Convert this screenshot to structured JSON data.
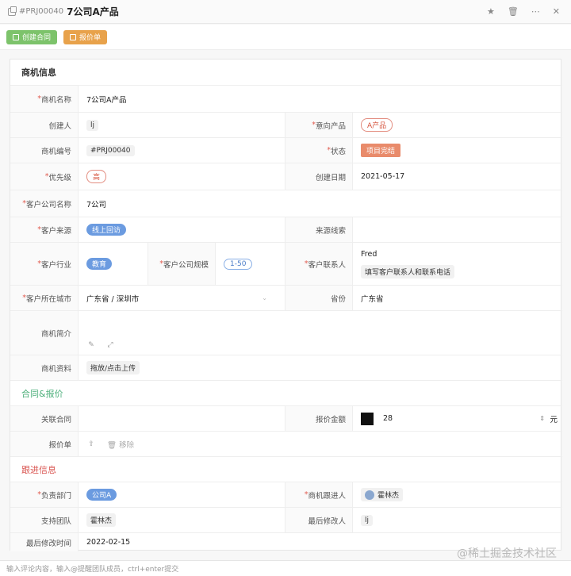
{
  "header": {
    "code": "#PRJ00040",
    "title": "7公司A产品"
  },
  "toolbar": {
    "create_contract": "创建合同",
    "quote": "报价单"
  },
  "sections": {
    "biz": "商机信息",
    "contract": "合同&报价",
    "follow": "跟进信息"
  },
  "fields": {
    "name_label": "商机名称",
    "name": "7公司A产品",
    "creator_label": "创建人",
    "creator": "lj",
    "product_label": "意向产品",
    "product": "A产品",
    "code_label": "商机编号",
    "code": "#PRJ00040",
    "status_label": "状态",
    "status": "项目完结",
    "priority_label": "优先级",
    "priority": "高",
    "created_label": "创建日期",
    "created": "2021-05-17",
    "company_label": "客户公司名称",
    "company": "7公司",
    "source_label": "客户来源",
    "source": "线上回访",
    "clue_label": "来源线索",
    "clue": "",
    "industry_label": "客户行业",
    "industry": "教育",
    "size_label": "客户公司规模",
    "size": "1-50",
    "contact_label": "客户联系人",
    "contact_name": "Fred",
    "contact_hint": "填写客户联系人和联系电话",
    "city_label": "客户所在城市",
    "city": "广东省 / 深圳市",
    "province_label": "省份",
    "province": "广东省",
    "intro_label": "商机简介",
    "files_label": "商机资料",
    "upload": "拖放/点击上传",
    "related_label": "关联合同",
    "amount_label": "报价金额",
    "amount": "28",
    "unit": "元",
    "quote_label": "报价单",
    "remove": "移除",
    "dept_label": "负责部门",
    "dept": "公司A",
    "owner_label": "商机跟进人",
    "owner": "霍林杰",
    "team_label": "支持团队",
    "team": "霍林杰",
    "modifier_label": "最后修改人",
    "modifier": "lj",
    "modtime_label": "最后修改时间",
    "modtime": "2022-02-15"
  },
  "comment": {
    "placeholder": "输入评论内容，输入@提醒团队成员，ctrl+enter提交"
  },
  "watermark": "@稀土掘金技术社区"
}
